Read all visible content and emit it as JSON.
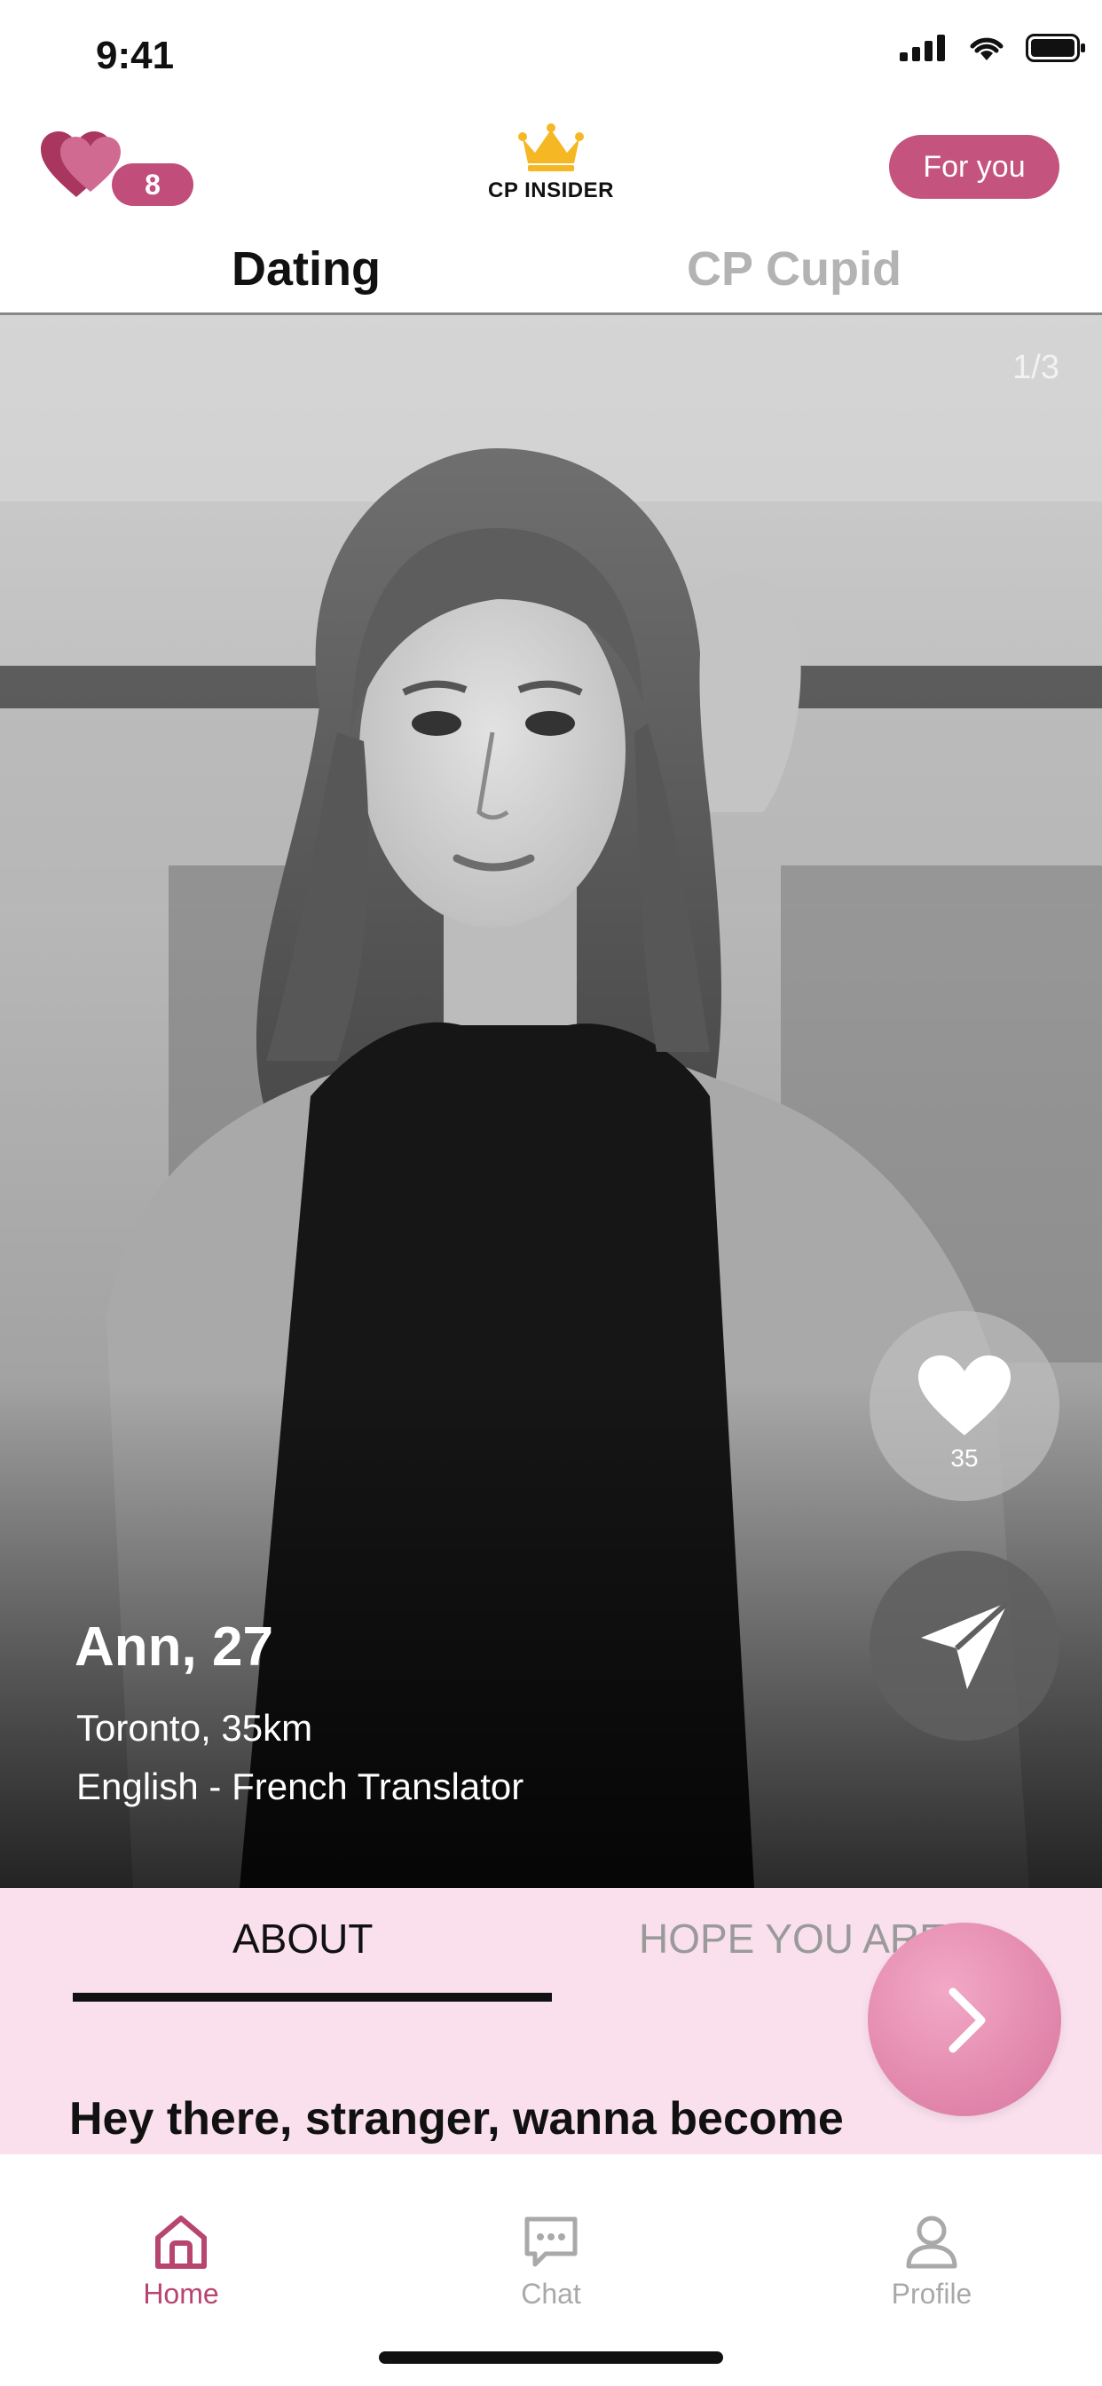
{
  "status_bar": {
    "time": "9:41"
  },
  "header": {
    "hearts_count": "8",
    "brand_name": "CP INSIDER",
    "for_you_label": "For you"
  },
  "tabs": [
    {
      "label": "Dating",
      "active": true
    },
    {
      "label": "CP Cupid",
      "active": false
    }
  ],
  "profile": {
    "photo_counter": "1/3",
    "name_age": "Ann, 27",
    "location": "Toronto, 35km",
    "occupation": "English - French Translator",
    "likes": "35"
  },
  "about": {
    "tabs": [
      {
        "label": "ABOUT",
        "active": true
      },
      {
        "label": "HOPE YOU ARE",
        "active": false
      }
    ],
    "text": "Hey there, stranger, wanna become"
  },
  "bottom_nav": [
    {
      "label": "Home",
      "icon": "home-icon",
      "active": true
    },
    {
      "label": "Chat",
      "icon": "chat-icon",
      "active": false
    },
    {
      "label": "Profile",
      "icon": "profile-icon",
      "active": false
    }
  ],
  "colors": {
    "accent": "#c4537d",
    "about_bg": "#f9e0ec",
    "crown": "#f5b824",
    "nav_active": "#b8456f",
    "nav_inactive": "#a9a9a9"
  }
}
